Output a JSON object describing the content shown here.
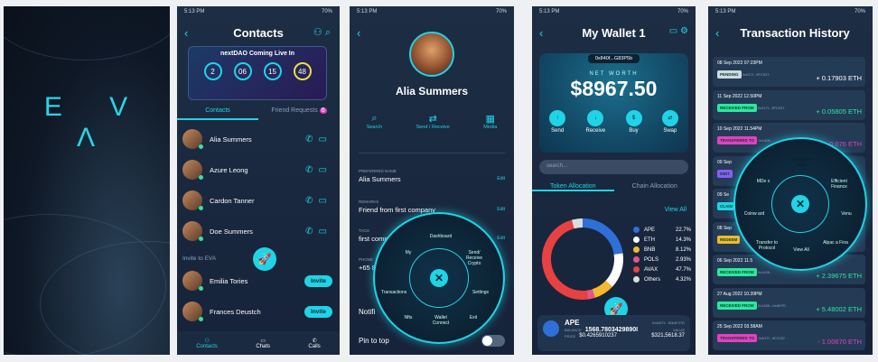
{
  "status_time": "5:13 PM",
  "status_batt": "70%",
  "splash": {
    "logo": "E V Λ"
  },
  "contacts": {
    "title": "Contacts",
    "banner_title": "nextDAO Coming Live In",
    "countdown": [
      "2",
      "06",
      "15",
      "48"
    ],
    "tab_contacts": "Contacts",
    "tab_requests": "Friend Requests",
    "requests_count": "6",
    "list": [
      "Alia Summers",
      "Azure Leong",
      "Cardon Tanner",
      "Doe Summers"
    ],
    "invite_header": "Invite to EVA",
    "invite_list": [
      "Emilia Tories",
      "Frances Deustch"
    ],
    "invite_label": "Invite",
    "nav": [
      "Contacts",
      "Chats",
      "Calls"
    ]
  },
  "profile": {
    "name": "Alia Summers",
    "actions": [
      "Search",
      "Send / Receive",
      "Media"
    ],
    "preferred_label": "PREFERRED NAME",
    "preferred_value": "Alia Summers",
    "remarks_label": "REMARKS",
    "remarks_value": "Friend from first company",
    "tags_label": "TAGS",
    "tags_value": "first comp",
    "phone_label": "PHONE",
    "phone_value": "+65 8",
    "edit": "Edit",
    "notif": "Notifi",
    "pin": "Pin to top",
    "wheel": [
      "Dashboard",
      "Send/ Receive Crypto",
      "Wallet Connect",
      "Transactions",
      "My",
      "Nfts",
      "Settings",
      "Exit"
    ]
  },
  "wallet": {
    "title": "My Wallet 1",
    "address": "0x840f...G83P5b",
    "networth_label": "NET WORTH",
    "networth": "$8967.50",
    "actions": [
      "Send",
      "Receive",
      "Buy",
      "Swap"
    ],
    "search_placeholder": "search...",
    "tab_token": "Token Allocation",
    "tab_chain": "Chain Allocation",
    "view_all": "View All",
    "legend": [
      {
        "n": "APE",
        "v": "22.7%",
        "c": "#2f6fd8"
      },
      {
        "n": "ETH",
        "v": "14.3%",
        "c": "#ffffff"
      },
      {
        "n": "BNB",
        "v": "8.12%",
        "c": "#f3ba2f"
      },
      {
        "n": "POLS",
        "v": "2.93%",
        "c": "#e6577e"
      },
      {
        "n": "AVAX",
        "v": "47.7%",
        "c": "#e84142"
      },
      {
        "n": "Others",
        "v": "4.32%",
        "c": "#dddddd"
      }
    ],
    "token": {
      "name": "APE",
      "addr": "0x4d07f...35b4F07D",
      "balance_label": "BALANCE",
      "balance": "1568.7803429890I",
      "price_label": "PRICE",
      "price": "$0.4265910237",
      "value_label": "VALUE",
      "value": "$321,5618.37"
    }
  },
  "history": {
    "title": "Transaction History",
    "items": [
      {
        "date": "08 Sep 2022  07:23PM",
        "type": "PENDING",
        "addr": "0x017f...9FC037",
        "amt": "+ 0.17903 ETH",
        "bc": "#cfd8e3",
        "ac": "#ffffff"
      },
      {
        "date": "11 Sep 2022  12.50PM",
        "type": "RECEIVED FROM",
        "addr": "0x017f...9FC037",
        "amt": "+ 0.05805 ETH",
        "bc": "#2ee7a0",
        "ac": "#2ee7a0"
      },
      {
        "date": "10 Sep 2022  11.54PM",
        "type": "TRANSFERED TO",
        "addr": "0x1406...",
        "amt": "- 0.076 ETH",
        "bc": "#e83ec4",
        "ac": "#e83ec4"
      },
      {
        "date": "09 Sep",
        "type": "MINT",
        "addr": "",
        "amt": "",
        "bc": "#8b5cf6",
        "ac": "#ffffff"
      },
      {
        "date": "09 Se",
        "type": "CLAIM",
        "addr": "",
        "amt": "",
        "bc": "#1fd4e6",
        "ac": "#ffffff"
      },
      {
        "date": "08 Sep",
        "type": "REDEEM",
        "addr": "",
        "amt": "",
        "bc": "#f3ba2f",
        "ac": "#ffffff"
      },
      {
        "date": "06 Sep 2022  11.5",
        "type": "RECEIVED FROM",
        "addr": "0x1406...",
        "amt": "+ 2.39675 ETH",
        "bc": "#2ee7a0",
        "ac": "#2ee7a0"
      },
      {
        "date": "27 Aug 2022  10.39PM",
        "type": "RECEIVED FROM",
        "addr": "0x1406...bb9EFE",
        "amt": "+ 5.48002 ETH",
        "bc": "#2ee7a0",
        "ac": "#2ee7a0"
      },
      {
        "date": "25 Sep 2022  03.58AM",
        "type": "TRANSFERED TO",
        "addr": "0x017f...9FC037",
        "amt": "- 1.00670 ETH",
        "bc": "#e83ec4",
        "ac": "#e83ec4"
      }
    ],
    "wheel": [
      "Pancake swap",
      "Efficient Finance",
      "Venu",
      "Alpac a Fina",
      "View All",
      "Transfer to Protocol",
      "Coinw ard",
      "MDe x",
      "Uniswap"
    ]
  }
}
